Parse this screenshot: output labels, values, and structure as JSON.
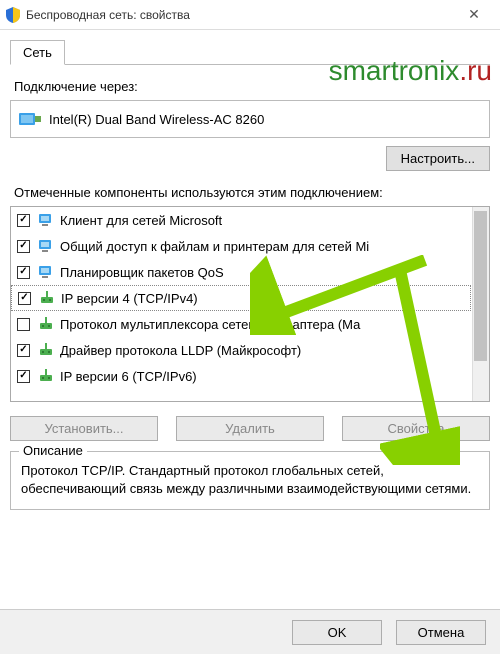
{
  "window": {
    "title": "Беспроводная сеть: свойства"
  },
  "watermark": {
    "part1": "smartronix",
    "part2": ".ru"
  },
  "tab": {
    "network": "Сеть"
  },
  "labels": {
    "connect_using": "Подключение через:",
    "components": "Отмеченные компоненты используются этим подключением:",
    "description_title": "Описание"
  },
  "adapter": {
    "name": "Intel(R) Dual Band Wireless-AC 8260"
  },
  "buttons": {
    "configure": "Настроить...",
    "install": "Установить...",
    "remove": "Удалить",
    "properties": "Свойства",
    "ok": "OK",
    "cancel": "Отмена"
  },
  "components": [
    {
      "checked": true,
      "icon": "client",
      "label": "Клиент для сетей Microsoft"
    },
    {
      "checked": true,
      "icon": "client",
      "label": "Общий доступ к файлам и принтерам для сетей Mi"
    },
    {
      "checked": true,
      "icon": "client",
      "label": "Планировщик пакетов QoS"
    },
    {
      "checked": true,
      "icon": "protocol",
      "label": "IP версии 4 (TCP/IPv4)",
      "selected": true
    },
    {
      "checked": false,
      "icon": "protocol",
      "label": "Протокол мультиплексора сетевого адаптера (Ма"
    },
    {
      "checked": true,
      "icon": "protocol",
      "label": "Драйвер протокола LLDP (Майкрософт)"
    },
    {
      "checked": true,
      "icon": "protocol",
      "label": "IP версии 6 (TCP/IPv6)"
    }
  ],
  "description": "Протокол TCP/IP. Стандартный протокол глобальных сетей, обеспечивающий связь между различными взаимодействующими сетями."
}
